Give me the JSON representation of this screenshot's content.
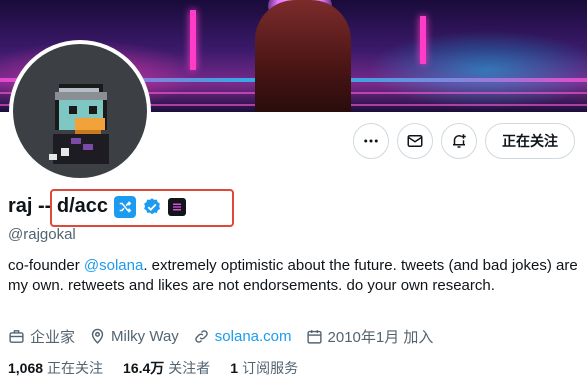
{
  "profile": {
    "display_name": "raj -- d/acc",
    "handle": "@rajgokal",
    "bio": {
      "before": "co-founder ",
      "link": "@solana",
      "after": ". extremely optimistic about the future. tweets (and bad jokes) are my own. retweets and likes are not endorsements. do your own research."
    },
    "meta": {
      "category": "企业家",
      "location": "Milky Way",
      "website": "solana.com",
      "joined": "2010年1月 加入"
    },
    "stats": {
      "following_count": "1,068",
      "following_label": "正在关注",
      "followers_count": "16.4万",
      "followers_label": "关注者",
      "subscriptions_count": "1",
      "subscriptions_label": "订阅服务"
    }
  },
  "actions": {
    "more_icon": "more-icon",
    "message_icon": "envelope-icon",
    "notify_icon": "bell-plus-icon",
    "follow_label": "正在关注"
  },
  "colors": {
    "accent": "#1d9bf0",
    "highlight": "#e0483a",
    "text_primary": "#0f1419",
    "text_secondary": "#536471"
  }
}
